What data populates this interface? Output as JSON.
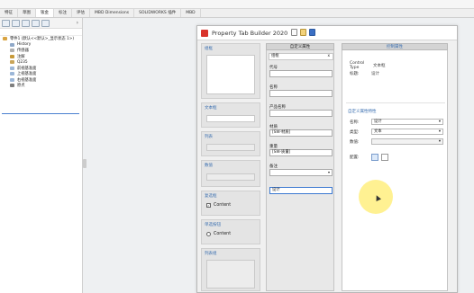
{
  "cmd_tabs": [
    {
      "label": "特征",
      "active": false
    },
    {
      "label": "草图",
      "active": false
    },
    {
      "label": "钣金",
      "active": true
    },
    {
      "label": "标注",
      "active": false
    },
    {
      "label": "评估",
      "active": false
    },
    {
      "label": "MBD Dimensions",
      "active": false
    },
    {
      "label": "SOLIDWORKS 插件",
      "active": false
    },
    {
      "label": "MBD",
      "active": false
    }
  ],
  "feature_tree": {
    "part": "零件1 (默认<<默认>_显示状态 1>)",
    "items": [
      {
        "label": "History",
        "icon_color": "#8fa8c8"
      },
      {
        "label": "传感器",
        "icon_color": "#b0b0b0"
      },
      {
        "label": "注解",
        "icon_color": "#c79a3a"
      },
      {
        "label": "Q235",
        "icon_color": "#c9a55a"
      },
      {
        "label": "前视基准面",
        "icon_color": "#9cb7d8"
      },
      {
        "label": "上视基准面",
        "icon_color": "#9cb7d8"
      },
      {
        "label": "右视基准面",
        "icon_color": "#9cb7d8"
      },
      {
        "label": "原点",
        "icon_color": "#7f7f7f"
      }
    ]
  },
  "ptb": {
    "title": "Property Tab Builder  2020"
  },
  "palette": {
    "groups": [
      {
        "label": "组框"
      },
      {
        "label": "文本框"
      },
      {
        "label": "列表"
      },
      {
        "label": "数值"
      },
      {
        "label": "复选框",
        "check_label": "Content"
      },
      {
        "label": "单选按钮",
        "radio_label": "Content"
      },
      {
        "label": "列表组"
      }
    ]
  },
  "custom_props": {
    "header": "自定义属性",
    "sub_title": "组框",
    "sub_close": "x",
    "fields": [
      {
        "label": "代号",
        "value": ""
      },
      {
        "label": "名称",
        "value": ""
      },
      {
        "label": "产品名称",
        "value": ""
      },
      {
        "label": "材质",
        "value": "[SW-材质]"
      },
      {
        "label": "重量",
        "value": "[SW-质量]"
      },
      {
        "label": "备注",
        "value": ""
      },
      {
        "label": "",
        "value": "设计"
      }
    ]
  },
  "control_attrs": {
    "header": "控制属性",
    "control_type_key": "Control Type",
    "control_type_val": "文本框",
    "caption_key": "标题:",
    "caption_val": "设计",
    "prop_section_title": "自定义属性特性",
    "name_key": "名称:",
    "name_val": "设计",
    "type_key": "类型:",
    "type_val": "文本",
    "value_key": "数值:",
    "value_val": "",
    "config_key": "配置:"
  }
}
